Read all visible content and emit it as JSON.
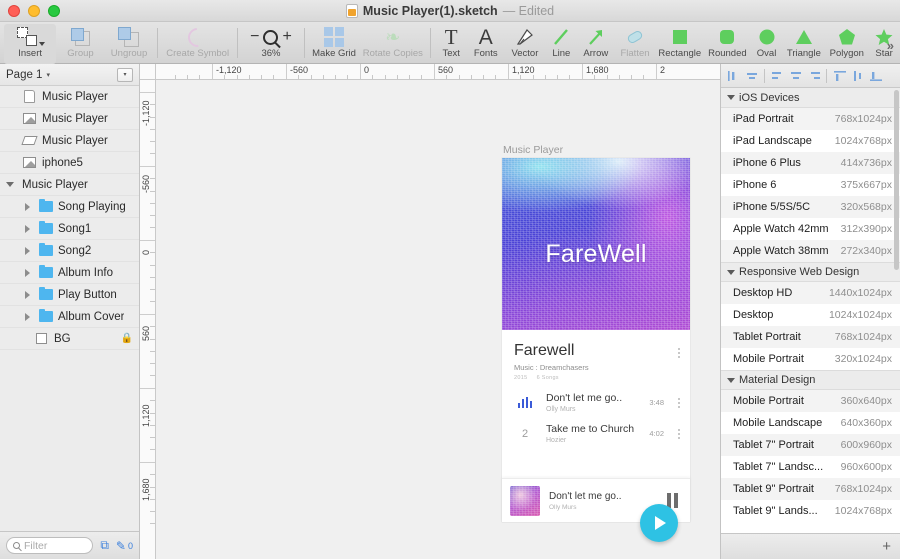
{
  "window": {
    "title": "Music Player(1).sketch",
    "edited_suffix": "— Edited",
    "doc_icon": "sketch-document-icon"
  },
  "toolbar": {
    "insert": {
      "label": "Insert",
      "icon": "insert-icon"
    },
    "items": [
      {
        "label": "Group",
        "icon": "group-icon",
        "dim": true
      },
      {
        "label": "Ungroup",
        "icon": "ungroup-icon",
        "dim": true
      },
      {
        "label": "Create Symbol",
        "icon": "create-symbol-icon",
        "dim": true
      },
      {
        "label": "Make Grid",
        "icon": "make-grid-icon",
        "dim": false
      },
      {
        "label": "Rotate Copies",
        "icon": "rotate-copies-icon",
        "dim": true
      },
      {
        "label": "Text",
        "icon": "text-icon",
        "dim": false
      },
      {
        "label": "Fonts",
        "icon": "fonts-icon",
        "dim": false
      },
      {
        "label": "Vector",
        "icon": "vector-pen-icon",
        "dim": false
      },
      {
        "label": "Line",
        "icon": "line-icon",
        "dim": false
      },
      {
        "label": "Arrow",
        "icon": "arrow-icon",
        "dim": false
      },
      {
        "label": "Flatten",
        "icon": "flatten-icon",
        "dim": true
      },
      {
        "label": "Rectangle",
        "icon": "rectangle-icon",
        "dim": false
      },
      {
        "label": "Rounded",
        "icon": "rounded-rectangle-icon",
        "dim": false
      },
      {
        "label": "Oval",
        "icon": "oval-icon",
        "dim": false
      },
      {
        "label": "Triangle",
        "icon": "triangle-icon",
        "dim": false
      },
      {
        "label": "Polygon",
        "icon": "polygon-icon",
        "dim": false
      },
      {
        "label": "Star",
        "icon": "star-icon",
        "dim": false
      }
    ],
    "zoom": {
      "level": "36%",
      "minus": "−",
      "plus": "+"
    },
    "overflow": "»"
  },
  "sidebar": {
    "page": {
      "name": "Page 1",
      "caret": "▾"
    },
    "layers": [
      {
        "name": "Music Player",
        "icon": "page-layer-icon",
        "indent": 1,
        "disclosure": false
      },
      {
        "name": "Music Player",
        "icon": "image-layer-icon",
        "indent": 1,
        "disclosure": false
      },
      {
        "name": "Music Player",
        "icon": "shape-layer-icon",
        "indent": 1,
        "disclosure": false
      },
      {
        "name": "iphone5",
        "icon": "image-layer-icon",
        "indent": 1,
        "disclosure": false
      },
      {
        "name": "Music Player",
        "icon": "artboard-icon",
        "indent": 0,
        "disclosure": "open"
      },
      {
        "name": "Song Playing",
        "icon": "folder-icon",
        "indent": 2,
        "disclosure": "closed"
      },
      {
        "name": "Song1",
        "icon": "folder-icon",
        "indent": 2,
        "disclosure": "closed"
      },
      {
        "name": "Song2",
        "icon": "folder-icon",
        "indent": 2,
        "disclosure": "closed"
      },
      {
        "name": "Album Info",
        "icon": "folder-icon",
        "indent": 2,
        "disclosure": "closed"
      },
      {
        "name": "Play Button",
        "icon": "folder-icon",
        "indent": 2,
        "disclosure": "closed"
      },
      {
        "name": "Album Cover",
        "icon": "folder-icon",
        "indent": 2,
        "disclosure": "closed"
      },
      {
        "name": "BG",
        "icon": "rect-layer-icon",
        "indent": 3,
        "disclosure": false,
        "locked": true,
        "lock_icon": "lock-icon"
      }
    ],
    "filter": {
      "placeholder": "Filter",
      "icon": "search-icon"
    },
    "bottom_icons": [
      {
        "name": "duplicate-icon",
        "glyph": "⧉"
      },
      {
        "name": "pencil-icon",
        "glyph": "✎"
      }
    ],
    "bottom_count": "0"
  },
  "rulers": {
    "horizontal": [
      "-1,120",
      "-560",
      "0",
      "560",
      "1,120",
      "1,680",
      "2"
    ],
    "vertical": [
      "-1,120",
      "-560",
      "0",
      "560",
      "1,120",
      "1,680"
    ]
  },
  "artboard": {
    "label": "Music Player",
    "album": {
      "title": "FareWell",
      "play_icon": "play-button-icon"
    },
    "info": {
      "heading": "Farewell",
      "subtitle": "Music : Dreamchasers",
      "meta_year": "2015",
      "meta_songs": "6 Songs",
      "menu_icon": "kebab-menu-icon"
    },
    "tracks": [
      {
        "lead": "equalizer-icon",
        "number": "",
        "title": "Don't let me go..",
        "artist": "Olly Murs",
        "duration": "3:48",
        "menu_icon": "kebab-menu-icon"
      },
      {
        "lead": "track-number",
        "number": "2",
        "title": "Take me to Church",
        "artist": "Hozier",
        "duration": "4:02",
        "menu_icon": "kebab-menu-icon"
      }
    ],
    "now_playing": {
      "thumb": "album-thumbnail",
      "title": "Don't let me go..",
      "artist": "Olly Murs",
      "control_icon": "pause-icon"
    }
  },
  "inspector": {
    "align_icons": [
      "align-left-icon",
      "align-center-horizontal-icon",
      "distribute-left-icon",
      "distribute-center-icon",
      "distribute-right-icon",
      "align-top-icon",
      "align-middle-icon",
      "align-bottom-icon"
    ],
    "groups": [
      {
        "title": "iOS Devices",
        "items": [
          {
            "name": "iPad Portrait",
            "size": "768x1024px"
          },
          {
            "name": "iPad Landscape",
            "size": "1024x768px"
          },
          {
            "name": "iPhone 6 Plus",
            "size": "414x736px"
          },
          {
            "name": "iPhone 6",
            "size": "375x667px"
          },
          {
            "name": "iPhone 5/5S/5C",
            "size": "320x568px"
          },
          {
            "name": "Apple Watch 42mm",
            "size": "312x390px"
          },
          {
            "name": "Apple Watch 38mm",
            "size": "272x340px"
          }
        ]
      },
      {
        "title": "Responsive Web Design",
        "items": [
          {
            "name": "Desktop HD",
            "size": "1440x1024px"
          },
          {
            "name": "Desktop",
            "size": "1024x1024px"
          },
          {
            "name": "Tablet Portrait",
            "size": "768x1024px"
          },
          {
            "name": "Mobile Portrait",
            "size": "320x1024px"
          }
        ]
      },
      {
        "title": "Material Design",
        "items": [
          {
            "name": "Mobile Portrait",
            "size": "360x640px"
          },
          {
            "name": "Mobile Landscape",
            "size": "640x360px"
          },
          {
            "name": "Tablet 7\" Portrait",
            "size": "600x960px"
          },
          {
            "name": "Tablet 7\" Landsc...",
            "size": "960x600px"
          },
          {
            "name": "Tablet 9\" Portrait",
            "size": "768x1024px"
          },
          {
            "name": "Tablet 9\" Lands...",
            "size": "1024x768px"
          }
        ]
      }
    ],
    "add_label": "+"
  },
  "colors": {
    "accent_blue": "#3a7fdc",
    "folder_blue": "#4eb6ef",
    "fab_cyan": "#2ec2e4",
    "shape_green": "#5ece5e",
    "album_violet": "#4b42d6",
    "album_magenta": "#b04ad4"
  }
}
